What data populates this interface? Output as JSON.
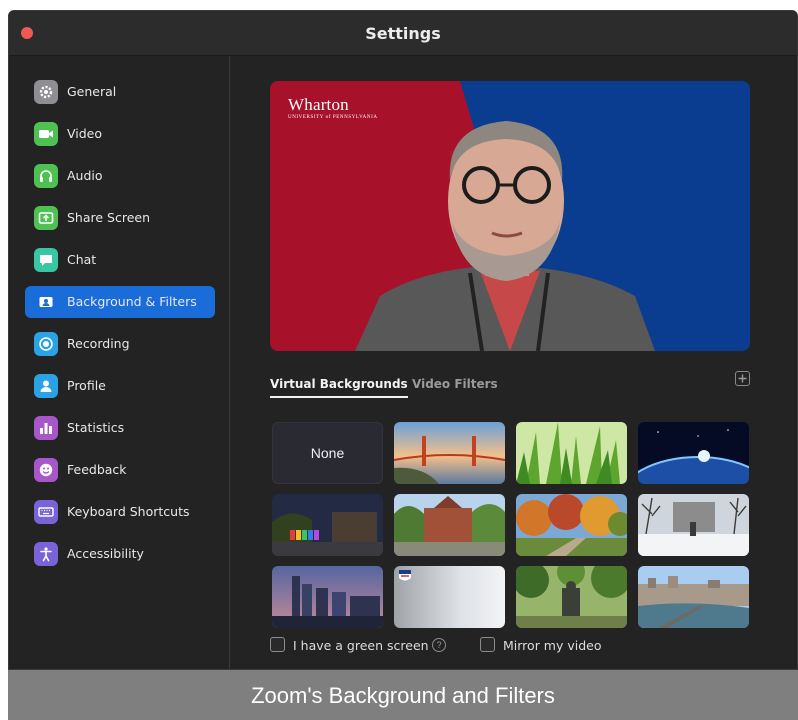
{
  "window": {
    "title": "Settings"
  },
  "sidebar": {
    "items": [
      {
        "label": "General",
        "icon": "gear-icon",
        "color": "#8e8e93"
      },
      {
        "label": "Video",
        "icon": "video-camera-icon",
        "color": "#4fc152"
      },
      {
        "label": "Audio",
        "icon": "headphones-icon",
        "color": "#4fc152"
      },
      {
        "label": "Share Screen",
        "icon": "share-screen-icon",
        "color": "#4fc152"
      },
      {
        "label": "Chat",
        "icon": "chat-bubble-icon",
        "color": "#38c6a3"
      },
      {
        "label": "Background & Filters",
        "icon": "person-card-icon",
        "color": "#1a6cd8",
        "active": true
      },
      {
        "label": "Recording",
        "icon": "record-icon",
        "color": "#2aa2e6"
      },
      {
        "label": "Profile",
        "icon": "person-icon",
        "color": "#2aa2e6"
      },
      {
        "label": "Statistics",
        "icon": "bar-chart-icon",
        "color": "#a857c9"
      },
      {
        "label": "Feedback",
        "icon": "smiley-icon",
        "color": "#a857c9"
      },
      {
        "label": "Keyboard Shortcuts",
        "icon": "keyboard-icon",
        "color": "#7a62d9"
      },
      {
        "label": "Accessibility",
        "icon": "accessibility-icon",
        "color": "#7a62d9"
      }
    ]
  },
  "preview": {
    "logo_name": "Wharton",
    "logo_subtitle": "UNIVERSITY of PENNSYLVANIA",
    "colors": {
      "red": "#a8112a",
      "blue": "#0a3d8f"
    }
  },
  "tabs": [
    {
      "label": "Virtual Backgrounds",
      "active": true
    },
    {
      "label": "Video Filters",
      "active": false
    }
  ],
  "add_button_icon": "plus-icon",
  "backgrounds": [
    {
      "label": "None",
      "type": "none",
      "selected": false
    },
    {
      "label": "",
      "type": "golden-gate-bridge"
    },
    {
      "label": "",
      "type": "grass"
    },
    {
      "label": "",
      "type": "earth-from-space"
    },
    {
      "label": "",
      "type": "campus-night-lights"
    },
    {
      "label": "",
      "type": "campus-building"
    },
    {
      "label": "",
      "type": "autumn-trees"
    },
    {
      "label": "",
      "type": "snowy-campus"
    },
    {
      "label": "",
      "type": "city-skyline-dusk"
    },
    {
      "label": "",
      "type": "gray-gradient-logo"
    },
    {
      "label": "",
      "type": "statue-trees"
    },
    {
      "label": "",
      "type": "city-river"
    }
  ],
  "options": {
    "green_screen": {
      "label": "I have a green screen",
      "checked": false,
      "help": "?"
    },
    "mirror": {
      "label": "Mirror my video",
      "checked": false
    }
  },
  "caption": "Zoom's Background and Filters"
}
